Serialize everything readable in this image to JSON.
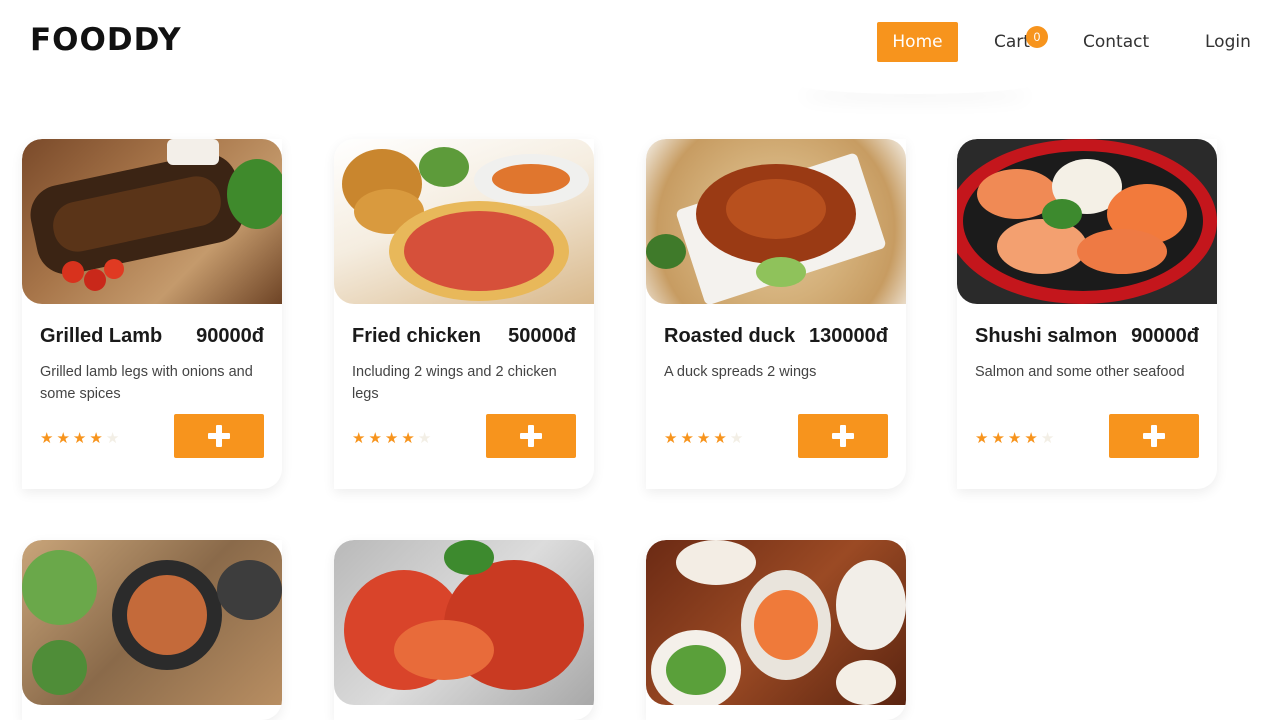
{
  "brand": {
    "logo": "FOODDY",
    "accent": "#f7941d"
  },
  "nav": {
    "home": "Home",
    "cart": "Cart",
    "cart_count": "0",
    "contact": "Contact",
    "login": "Login"
  },
  "products": [
    {
      "name": "Grilled Lamb",
      "price": "90000đ",
      "description": "Grilled lamb legs with onions and some spices",
      "rating": 4,
      "image": "grilled-lamb-image"
    },
    {
      "name": "Fried chicken",
      "price": "50000đ",
      "description": "Including 2 wings and 2 chicken legs",
      "rating": 4,
      "image": "fried-chicken-pizza-image"
    },
    {
      "name": "Roasted duck",
      "price": "130000đ",
      "description": "A duck spreads 2 wings",
      "rating": 4,
      "image": "roasted-duck-image"
    },
    {
      "name": "Shushi salmon",
      "price": "90000đ",
      "description": "Salmon and some other seafood",
      "rating": 4,
      "image": "sushi-salmon-image"
    }
  ],
  "more_products": [
    {
      "image": "grilled-platter-image"
    },
    {
      "image": "spicy-lobster-image"
    },
    {
      "image": "shrimp-seafood-image"
    }
  ]
}
